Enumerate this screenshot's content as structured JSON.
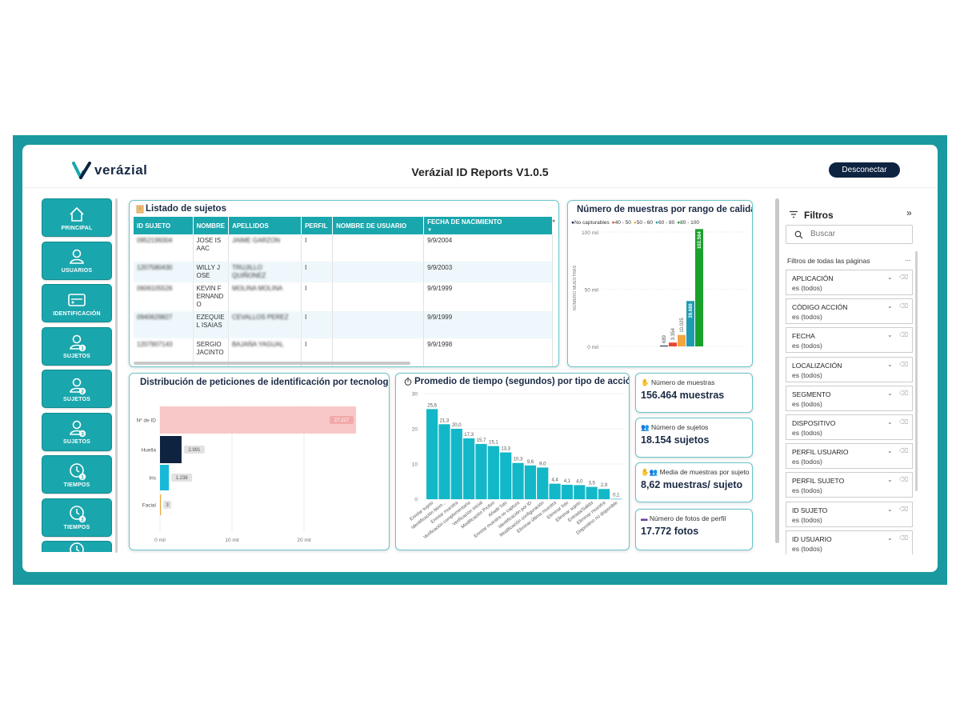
{
  "app": {
    "logo_text": "verázial",
    "title": "Verázial ID Reports V1.0.5",
    "logout_label": "Desconectar"
  },
  "nav": [
    {
      "label": "PRINCIPAL",
      "icon": "home-icon"
    },
    {
      "label": "USUARIOS",
      "icon": "user-icon"
    },
    {
      "label": "IDENTIFICACIÓN",
      "icon": "id-card-icon"
    },
    {
      "label": "SUJETOS",
      "icon": "user-1-icon",
      "badge": "1"
    },
    {
      "label": "SUJETOS",
      "icon": "user-2-icon",
      "badge": "2"
    },
    {
      "label": "SUJETOS",
      "icon": "user-3-icon",
      "badge": "3"
    },
    {
      "label": "TIEMPOS",
      "icon": "clock-1-icon",
      "badge": "1"
    },
    {
      "label": "TIEMPOS",
      "icon": "clock-2-icon",
      "badge": "2"
    }
  ],
  "subjects_table": {
    "title": "Listado de sujetos",
    "columns": [
      "ID SUJETO",
      "NOMBRE",
      "APELLIDOS",
      "PERFIL",
      "NOMBRE DE USUARIO",
      "FECHA DE NACIMIENTO"
    ],
    "rows": [
      {
        "id": "0952199304",
        "nombre": "JOSE ISAAC",
        "apellidos": "JAIME GARZON",
        "perfil": "I",
        "usuario": "",
        "fecha": "9/9/2004"
      },
      {
        "id": "1207580430",
        "nombre": "WILLY JOSE",
        "apellidos": "TRUJILLO QUIÑONEZ",
        "perfil": "I",
        "usuario": "",
        "fecha": "9/9/2003"
      },
      {
        "id": "0606105526",
        "nombre": "KEVIN FERNANDO",
        "apellidos": "MOLINA MOLINA",
        "perfil": "I",
        "usuario": "",
        "fecha": "9/9/1999"
      },
      {
        "id": "0940629827",
        "nombre": "EZEQUIEL ISAIAS",
        "apellidos": "CEVALLOS PEREZ",
        "perfil": "I",
        "usuario": "",
        "fecha": "9/9/1999"
      },
      {
        "id": "1207907143",
        "nombre": "SERGIO JACINTO",
        "apellidos": "BAJAÑA YAGUAL",
        "perfil": "I",
        "usuario": "",
        "fecha": "9/9/1998"
      }
    ]
  },
  "kpis": [
    {
      "label": "Número de muestras",
      "value": "156.464 muestras"
    },
    {
      "label": "Número de sujetos",
      "value": "18.154 sujetos"
    },
    {
      "label": "Media de muestras por sujeto",
      "value": "8,62 muestras/ sujeto"
    },
    {
      "label": "Número de fotos de perfil",
      "value": "17.772 fotos"
    }
  ],
  "filters": {
    "title": "Filtros",
    "search_placeholder": "Buscar",
    "all_pages_label": "Filtros de todas las páginas",
    "more": "...",
    "collapse": "»",
    "items": [
      {
        "name": "APLICACIÓN",
        "value": "es (todos)"
      },
      {
        "name": "CÓDIGO ACCIÓN",
        "value": "es (todos)"
      },
      {
        "name": "FECHA",
        "value": "es (todos)"
      },
      {
        "name": "LOCALIZACIÓN",
        "value": "es (todos)"
      },
      {
        "name": "SEGMENTO",
        "value": "es (todos)"
      },
      {
        "name": "DISPOSITIVO",
        "value": "es (todos)"
      },
      {
        "name": "PERFIL USUARIO",
        "value": "es (todos)"
      },
      {
        "name": "PERFIL SUJETO",
        "value": "es (todos)"
      },
      {
        "name": "ID SUJETO",
        "value": "es (todos)"
      },
      {
        "name": "ID USUARIO",
        "value": "es (todos)"
      }
    ]
  },
  "colors": {
    "teal": "#1aa6ad",
    "navy": "#0d2340",
    "quality_colors": [
      "#0d2340",
      "#e8472e",
      "#f4a540",
      "#1d9bb3",
      "#1aa12c"
    ],
    "tech_colors": [
      "#f8c8c8",
      "#0d2340",
      "#1ab8d8",
      "#e8a838"
    ],
    "time_bar": "#12b8c8"
  },
  "chart_data": [
    {
      "type": "bar",
      "title": "Número de muestras por rango de calidad",
      "categories": [
        "No capturables",
        "40 - 50",
        "50 - 60",
        "60 - 80",
        "80 - 100"
      ],
      "values": [
        689,
        3354,
        10025,
        39686,
        102564
      ],
      "value_labels": [
        "689",
        "3.354",
        "10.025",
        "39.686",
        "102.564"
      ],
      "ylabel": "NÚMERO MUESTRAS",
      "yticks": [
        "0 mil",
        "50 mil",
        "100 mil"
      ],
      "ylim": [
        0,
        100000
      ],
      "legend": "top"
    },
    {
      "type": "bar",
      "orientation": "horizontal",
      "title": "Distribución de peticiones de identificación por tecnología",
      "categories": [
        "Nº de ID",
        "Huella",
        "Iris",
        "Facial"
      ],
      "values": [
        27227,
        2991,
        1238,
        3
      ],
      "value_labels": [
        "27.227",
        "2.991",
        "1.238",
        "3"
      ],
      "xticks": [
        "0 mil",
        "10 mil",
        "20 mil"
      ],
      "xlim": [
        0,
        30000
      ]
    },
    {
      "type": "bar",
      "title": "Promedio de tiempo (segundos) por tipo de acción",
      "categories": [
        "Enrolar sujeto",
        "Identificación biom...",
        "Enrolar muestra",
        "Verificación complementaria",
        "Verificación inicial",
        "Modificación Proforr",
        "Añadir foto",
        "Enrolar muestra no captura",
        "Identificación por ID",
        "Modificación configuración",
        "Eliminar última muestra",
        "Eliminar foto",
        "Eliminar sujeto",
        "Entrada/Salida",
        "Eliminar muestra",
        "Dispositivo no disponible"
      ],
      "values": [
        25.6,
        21.3,
        20.0,
        17.3,
        15.7,
        15.1,
        13.3,
        10.3,
        9.6,
        9.0,
        4.4,
        4.1,
        4.0,
        3.5,
        2.9,
        0.1
      ],
      "value_labels": [
        "25,6",
        "21,3",
        "20,0",
        "17,3",
        "15,7",
        "15,1",
        "13,3",
        "10,3",
        "9,6",
        "9,0",
        "4,4",
        "4,1",
        "4,0",
        "3,5",
        "2,9",
        "0,1"
      ],
      "yticks": [
        "0",
        "10",
        "20",
        "30"
      ],
      "ylim": [
        0,
        30
      ]
    }
  ]
}
